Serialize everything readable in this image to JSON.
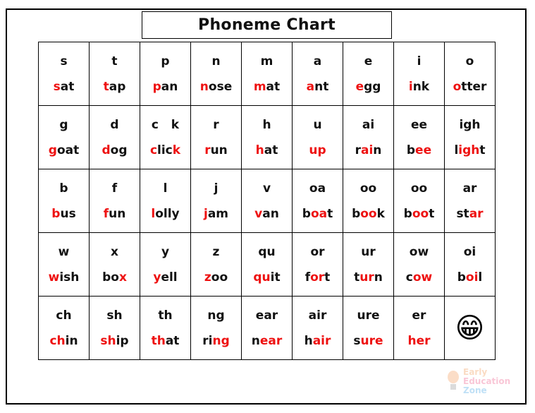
{
  "title": "Phoneme Chart",
  "colors": {
    "highlight": "#ee1111",
    "text": "#111111"
  },
  "rows": [
    [
      {
        "phoneme": "s",
        "word": [
          [
            "s",
            true
          ],
          [
            "at",
            false
          ]
        ]
      },
      {
        "phoneme": "t",
        "word": [
          [
            "t",
            true
          ],
          [
            "ap",
            false
          ]
        ]
      },
      {
        "phoneme": "p",
        "word": [
          [
            "p",
            true
          ],
          [
            "an",
            false
          ]
        ]
      },
      {
        "phoneme": "n",
        "word": [
          [
            "n",
            true
          ],
          [
            "ose",
            false
          ]
        ]
      },
      {
        "phoneme": "m",
        "word": [
          [
            "m",
            true
          ],
          [
            "at",
            false
          ]
        ]
      },
      {
        "phoneme": "a",
        "word": [
          [
            "a",
            true
          ],
          [
            "nt",
            false
          ]
        ]
      },
      {
        "phoneme": "e",
        "word": [
          [
            "e",
            true
          ],
          [
            "gg",
            false
          ]
        ]
      },
      {
        "phoneme": "i",
        "word": [
          [
            "i",
            true
          ],
          [
            "nk",
            false
          ]
        ]
      },
      {
        "phoneme": "o",
        "word": [
          [
            "o",
            true
          ],
          [
            "tter",
            false
          ]
        ]
      }
    ],
    [
      {
        "phoneme": "g",
        "word": [
          [
            "g",
            true
          ],
          [
            "oat",
            false
          ]
        ]
      },
      {
        "phoneme": "d",
        "word": [
          [
            "d",
            true
          ],
          [
            "og",
            false
          ]
        ]
      },
      {
        "phoneme": "c   k",
        "word": [
          [
            "c",
            true
          ],
          [
            "lic",
            false
          ],
          [
            "k",
            true
          ]
        ]
      },
      {
        "phoneme": "r",
        "word": [
          [
            "r",
            true
          ],
          [
            "un",
            false
          ]
        ]
      },
      {
        "phoneme": "h",
        "word": [
          [
            "h",
            true
          ],
          [
            "at",
            false
          ]
        ]
      },
      {
        "phoneme": "u",
        "word": [
          [
            "up",
            true
          ]
        ]
      },
      {
        "phoneme": "ai",
        "word": [
          [
            "r",
            false
          ],
          [
            "ai",
            true
          ],
          [
            "n",
            false
          ]
        ]
      },
      {
        "phoneme": "ee",
        "word": [
          [
            "b",
            false
          ],
          [
            "ee",
            true
          ]
        ]
      },
      {
        "phoneme": "igh",
        "word": [
          [
            "l",
            false
          ],
          [
            "igh",
            true
          ],
          [
            "t",
            false
          ]
        ]
      }
    ],
    [
      {
        "phoneme": "b",
        "word": [
          [
            "b",
            true
          ],
          [
            "us",
            false
          ]
        ]
      },
      {
        "phoneme": "f",
        "word": [
          [
            "f",
            true
          ],
          [
            "un",
            false
          ]
        ]
      },
      {
        "phoneme": "l",
        "word": [
          [
            "l",
            true
          ],
          [
            "olly",
            false
          ]
        ]
      },
      {
        "phoneme": "j",
        "word": [
          [
            "j",
            true
          ],
          [
            "am",
            false
          ]
        ]
      },
      {
        "phoneme": "v",
        "word": [
          [
            "v",
            true
          ],
          [
            "an",
            false
          ]
        ]
      },
      {
        "phoneme": "oa",
        "word": [
          [
            "b",
            false
          ],
          [
            "oa",
            true
          ],
          [
            "t",
            false
          ]
        ]
      },
      {
        "phoneme": "oo",
        "word": [
          [
            "b",
            false
          ],
          [
            "oo",
            true
          ],
          [
            "k",
            false
          ]
        ]
      },
      {
        "phoneme": "oo",
        "word": [
          [
            "b",
            false
          ],
          [
            "oo",
            true
          ],
          [
            "t",
            false
          ]
        ]
      },
      {
        "phoneme": "ar",
        "word": [
          [
            "st",
            false
          ],
          [
            "ar",
            true
          ]
        ]
      }
    ],
    [
      {
        "phoneme": "w",
        "word": [
          [
            "w",
            true
          ],
          [
            "ish",
            false
          ]
        ]
      },
      {
        "phoneme": "x",
        "word": [
          [
            "bo",
            false
          ],
          [
            "x",
            true
          ]
        ]
      },
      {
        "phoneme": "y",
        "word": [
          [
            "y",
            true
          ],
          [
            "ell",
            false
          ]
        ]
      },
      {
        "phoneme": "z",
        "word": [
          [
            "z",
            true
          ],
          [
            "oo",
            false
          ]
        ]
      },
      {
        "phoneme": "qu",
        "word": [
          [
            "qu",
            true
          ],
          [
            "it",
            false
          ]
        ]
      },
      {
        "phoneme": "or",
        "word": [
          [
            "f",
            false
          ],
          [
            "or",
            true
          ],
          [
            "t",
            false
          ]
        ]
      },
      {
        "phoneme": "ur",
        "word": [
          [
            "t",
            false
          ],
          [
            "ur",
            true
          ],
          [
            "n",
            false
          ]
        ]
      },
      {
        "phoneme": "ow",
        "word": [
          [
            "c",
            false
          ],
          [
            "ow",
            true
          ]
        ]
      },
      {
        "phoneme": "oi",
        "word": [
          [
            "b",
            false
          ],
          [
            "oi",
            true
          ],
          [
            "l",
            false
          ]
        ]
      }
    ],
    [
      {
        "phoneme": "ch",
        "word": [
          [
            "ch",
            true
          ],
          [
            "in",
            false
          ]
        ]
      },
      {
        "phoneme": "sh",
        "word": [
          [
            "sh",
            true
          ],
          [
            "ip",
            false
          ]
        ]
      },
      {
        "phoneme": "th",
        "word": [
          [
            "th",
            true
          ],
          [
            "at",
            false
          ]
        ]
      },
      {
        "phoneme": "ng",
        "word": [
          [
            "ri",
            false
          ],
          [
            "ng",
            true
          ]
        ]
      },
      {
        "phoneme": "ear",
        "word": [
          [
            "n",
            false
          ],
          [
            "ear",
            true
          ]
        ]
      },
      {
        "phoneme": "air",
        "word": [
          [
            "h",
            false
          ],
          [
            "air",
            true
          ]
        ]
      },
      {
        "phoneme": "ure",
        "word": [
          [
            "s",
            false
          ],
          [
            "ure",
            true
          ]
        ]
      },
      {
        "phoneme": "er",
        "word": [
          [
            "her",
            true
          ]
        ]
      },
      {
        "emoji": "😁",
        "emoji_name": "grinning-face-icon"
      }
    ]
  ],
  "logo": {
    "line1": "Early",
    "line2": "Education",
    "line3": "Zone"
  }
}
